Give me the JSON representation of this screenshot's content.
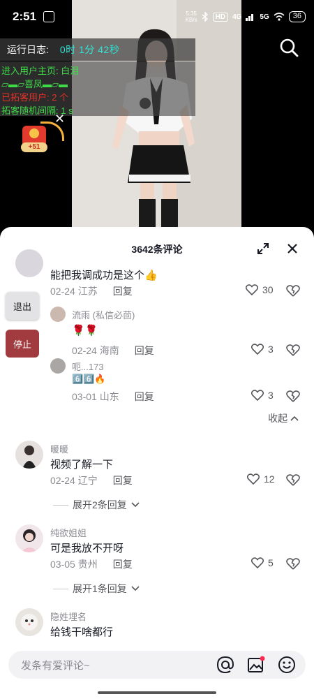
{
  "status_bar": {
    "time": "2:51",
    "net_speed": "5.35",
    "net_unit": "KB/s",
    "hd_label": "HD",
    "signal_4g": "4G",
    "signal_5g": "5G",
    "battery": "36"
  },
  "log": {
    "title": "运行日志:",
    "timer": "0时 1分 42秒",
    "lines": [
      "进入用户主页: 白泪",
      "▱▬▱喜凤▬▱▬",
      "已拓客用户: 2 个",
      "拓客随机间隔: 1 s"
    ]
  },
  "red_packet": {
    "badge": "+51"
  },
  "sheet": {
    "title": "3642条评论"
  },
  "side_buttons": {
    "exit": "退出",
    "stop": "停止"
  },
  "comments": [
    {
      "name": "",
      "text": "能把我调成功是这个👍",
      "date": "02-24",
      "location": "江苏",
      "reply": "回复",
      "likes": "30"
    },
    {
      "name": "流雨 (私信必茴)",
      "text": "🌹🌹",
      "date": "02-24",
      "location": "海南",
      "reply": "回复",
      "likes": "3"
    },
    {
      "name": "呃...173",
      "text": "6️⃣6️⃣🔥",
      "date": "03-01",
      "location": "山东",
      "reply": "回复",
      "likes": "3"
    },
    {
      "name": "暖暖",
      "text": "视频了解一下",
      "date": "02-24",
      "location": "辽宁",
      "reply": "回复",
      "likes": "12"
    },
    {
      "name": "纯欲姐姐",
      "text": "可是我放不开呀",
      "date": "03-05",
      "location": "贵州",
      "reply": "回复",
      "likes": "5"
    },
    {
      "name": "隐姓埋名",
      "text": "给钱干啥都行",
      "date": "",
      "location": "",
      "reply": "",
      "likes": ""
    }
  ],
  "collapse_label": "收起",
  "expand_labels": [
    "展开2条回复",
    "展开1条回复"
  ],
  "input": {
    "placeholder": "发条有爱评论~"
  },
  "icons": {
    "search": "search-icon",
    "expand": "expand-icon",
    "close": "close-icon",
    "like": "heart-icon",
    "dislike": "broken-heart-icon",
    "mention": "at-icon",
    "image": "image-icon",
    "emoji": "emoji-icon"
  },
  "colors": {
    "log_green": "#3fdc4a",
    "log_red": "#e8302a",
    "timer_cyan": "#2ee6d6",
    "stop_button": "#a23b3f"
  }
}
